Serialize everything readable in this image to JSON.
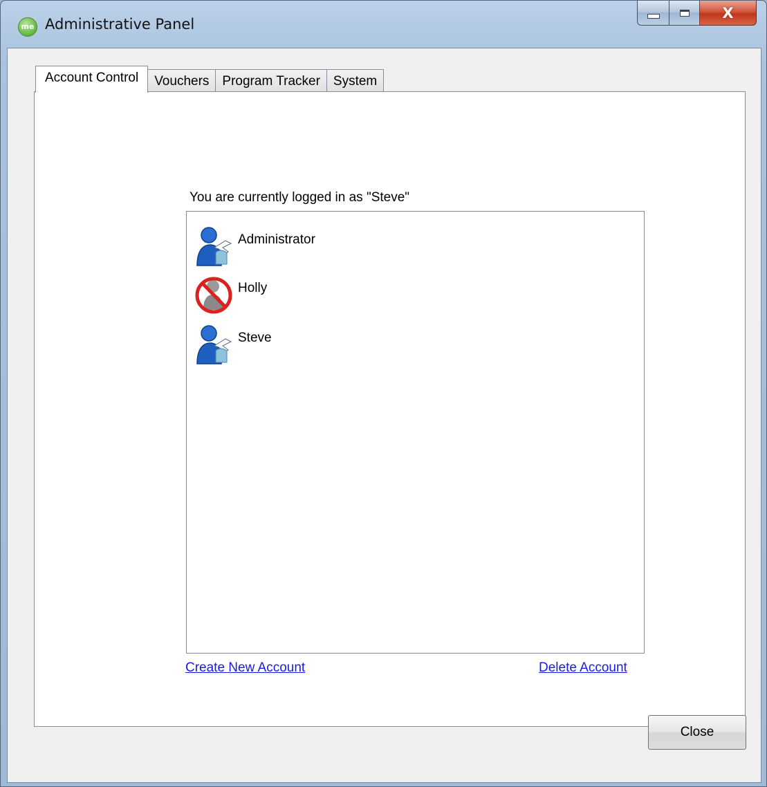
{
  "window": {
    "title": "Administrative Panel",
    "app_icon_text": "me",
    "minimize_label": "",
    "maximize_label": "",
    "close_glyph": "X"
  },
  "tabs": [
    {
      "label": "Account Control",
      "active": true
    },
    {
      "label": "Vouchers",
      "active": false
    },
    {
      "label": "Program Tracker",
      "active": false
    },
    {
      "label": "System",
      "active": false
    }
  ],
  "account_control": {
    "logged_in_text": "You are currently logged in as \"Steve\"",
    "accounts": [
      {
        "name": "Administrator",
        "icon": "admin-user-icon",
        "status": "active"
      },
      {
        "name": "Holly",
        "icon": "disabled-user-icon",
        "status": "disabled"
      },
      {
        "name": "Steve",
        "icon": "admin-user-icon",
        "status": "active"
      }
    ],
    "create_link": "Create New Account",
    "delete_link": "Delete Account"
  },
  "footer": {
    "close_button": "Close"
  },
  "colors": {
    "link": "#1a1ae6",
    "user_blue": "#1f5fbf",
    "disabled_red": "#d8231f"
  }
}
